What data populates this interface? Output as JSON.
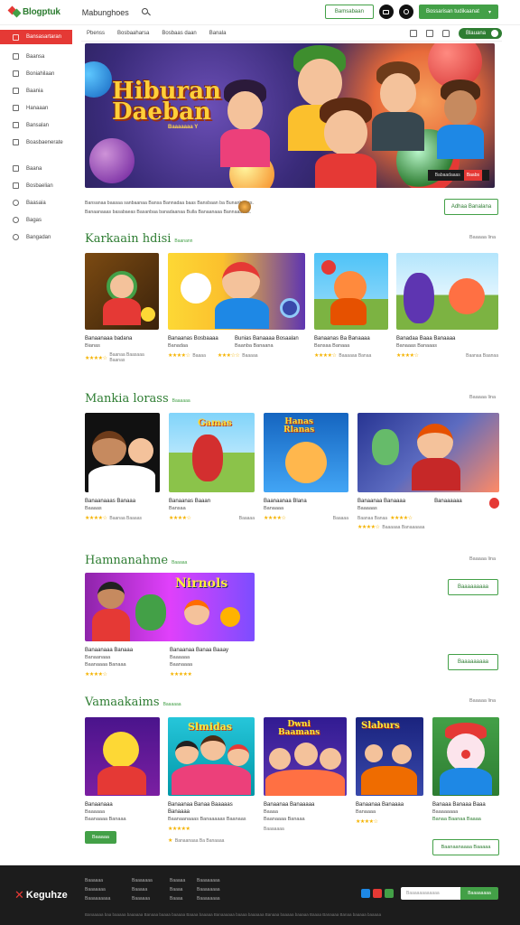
{
  "header": {
    "logo_text": "Blogptuk",
    "site_title": "Mabunghoes",
    "btn_login": "Bamsabaan",
    "btn_signup": "Bossarisan tudikaanat"
  },
  "sidebar": {
    "active_label": "Bansasartaran",
    "group1": [
      "Baansa",
      "Boniahilaan",
      "Baania",
      "Hanaaan",
      "Bansalan",
      "Boasbaenerate"
    ],
    "group2": [
      "Baana",
      "Bosbaelian",
      "Baasaia",
      "Bagas",
      "Bangadan"
    ]
  },
  "subnav": {
    "items": [
      "Pbenss",
      "Bosbaaharsa",
      "Bosbaas daan",
      "Banala"
    ],
    "toggle_label": "Blauana"
  },
  "hero": {
    "title_line1": "Hiburan",
    "title_line2": "Daeban",
    "subtitle": "Baaaaaaa Y",
    "cta": "Babaadaaas",
    "cta_badge": "Baabs"
  },
  "intro": {
    "line1": "Bansanaa baasaa sanbaanaa Bansa Bannadaa baas Bansbaan ba Bunanbaaas.",
    "line2": "Banaanaaas basabaeas Basanbaa banadaanaa Bulla Banaanaaa Bannaaaaas.",
    "button": "Adhaa Banalana"
  },
  "sections": [
    {
      "title": "Karkaain hdisi",
      "badge": "Baanann",
      "see_all": "Baaaaa lina",
      "cards": [
        {
          "t1": "Banaanaaa badana",
          "t2": "Bianas",
          "meta": "Baanaa Baasaaa Baanas",
          "stars": "★★★★☆"
        },
        {
          "t1": "Banaanas Bosbaaaa",
          "t2": "Banadaa",
          "meta": "Baaaa",
          "stars": "★★★★☆"
        },
        {
          "t1": "Bunias Banaaaa Bosaalan",
          "t2": "Baanba Banaana",
          "meta": "Baaaaa",
          "stars": "★★★☆☆"
        },
        {
          "t1": "Banaanas Ba Banaaaa",
          "t2": "Bansaa Banaaa",
          "meta": "Baaaaaa Banaa",
          "stars": "★★★★☆"
        },
        {
          "t1": "Banadaa Baaa Banaaaa",
          "t2": "Banaaas Banaaas",
          "meta": "Baanaa Baanaa",
          "stars": "★★★★☆"
        }
      ]
    },
    {
      "title": "Mankia lorass",
      "badge": "Baaaaaa",
      "see_all": "Baaaaa lina",
      "cards": [
        {
          "t1": "Banaanaaas Banaaa",
          "t2": "Baaaas",
          "meta": "Baanaa Baaaas",
          "stars": "★★★★☆"
        },
        {
          "t1": "Banaanas Baaan",
          "t2": "Bansaa",
          "meta": "Baanaaaa",
          "stars": "★★★★☆"
        },
        {
          "t1": "Baanaanaa Blana",
          "t2": "Banaaaa",
          "meta": "Baanaaa",
          "stars": "★★★★☆"
        },
        {
          "t1": "Banaanaa Banaaaa",
          "t2": "Baaaaas",
          "meta": "Baanaa Banaa",
          "stars": "★★★★☆"
        },
        {
          "t1": "Banaaaaaa",
          "t2": "",
          "meta": "Banaaaaaaa Banaaaa",
          "stars": "★★★★☆"
        }
      ],
      "extra": [
        "Baaaaa",
        "Baaaaa",
        "Baaaaaa Banaaaaaa"
      ]
    },
    {
      "title": "Hamnanahme",
      "badge": "Baaaaa",
      "see_all": "Baaaaa lina",
      "banner_text": "Nirnols",
      "cards": [
        {
          "t1": "Banaanaaa Banaaa",
          "t2": "Banaanaaa",
          "meta": "Baanaaaa Banaaa",
          "stars": "★★★★☆"
        },
        {
          "t1": "Banaanaa Banaa Baaay",
          "t2": "Baaaaaa",
          "meta": "Baanaaaa",
          "stars": "★★★★★"
        }
      ],
      "button1": "Baaaaaaaaa",
      "button2": "Baaaaaaaaa"
    },
    {
      "title": "Vamaakaims",
      "badge": "Baaaaaa",
      "see_all": "Baaaaa lina",
      "cards": [
        {
          "t1": "Banaanaaa",
          "t2": "Baaaaaa",
          "meta": "Baanaaaa Banaaa",
          "stars": "",
          "button": "Baaaaa"
        },
        {
          "t1": "Banaanaa Banaa Baaaaas Banaaaa",
          "t2": "Baanaanaaas Banaaaaas Baanaas",
          "meta": "",
          "stars": "★★★★★",
          "button": "Banaanaaa Ba Banaaaa"
        },
        {
          "t1": "Banaanaa Banaaaaa",
          "t2": "Baaaa",
          "meta": "Baanaaaa Banaaa",
          "stars": "",
          "button": "Baaaaaaa"
        },
        {
          "t1": "Banaanaa Banaaaa",
          "t2": "Banaaaa",
          "meta": "",
          "stars": "★★★★☆",
          "button": ""
        },
        {
          "t1": "Banaaa Banaaa Baaa",
          "t2": "Baaaaaaaa",
          "meta": "Banaa Baanaa Baaaa",
          "stars": "",
          "button": "Baanaanaaaa Baaaaa"
        }
      ]
    }
  ],
  "footer": {
    "logo_text": "Keguhze",
    "col1": [
      "Baaaaaa",
      "Baaaaaaa",
      "Baaaaaaaaa"
    ],
    "col2": [
      "Baaaaaaa",
      "Baaaaa",
      "Baaaaaa"
    ],
    "col3": [
      "Baaaaa",
      "Baaaa",
      "Baaaa"
    ],
    "col4": [
      "Baaaaaaaa",
      "Baaaaaaaa",
      "Baaaaaaaa"
    ],
    "newsletter_placeholder": "Baaaaaaaaaaaa",
    "subscribe": "Baaaaaaaa",
    "bottom_text": "Banaaaaa baa baaaaa baaaaaa Banaaa baaaa baaaaa Baaaa baaaaa Banaaaaaa baaaa baaaaaa Banaaa baaaaa baaaaa Baaaa Banaaaa Banaa baaaaa baaaaa"
  },
  "colors": {
    "accent": "#43a047",
    "brand_red": "#e53935",
    "title_green": "#2e7d32"
  }
}
